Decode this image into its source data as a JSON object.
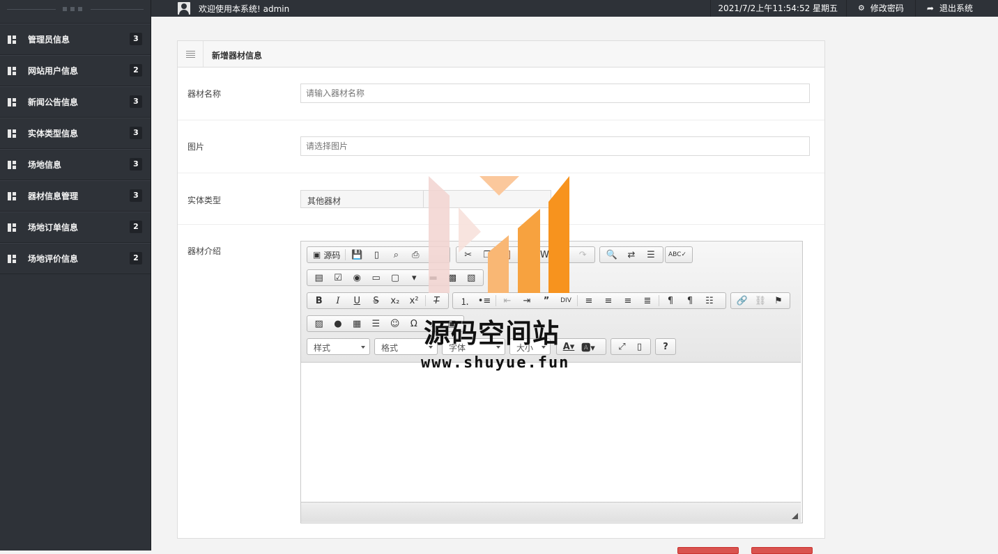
{
  "sidebar": {
    "items": [
      {
        "label": "管理员信息",
        "badge": "3"
      },
      {
        "label": "网站用户信息",
        "badge": "2"
      },
      {
        "label": "新闻公告信息",
        "badge": "3"
      },
      {
        "label": "实体类型信息",
        "badge": "3"
      },
      {
        "label": "场地信息",
        "badge": "3"
      },
      {
        "label": "器材信息管理",
        "badge": "3"
      },
      {
        "label": "场地订单信息",
        "badge": "2"
      },
      {
        "label": "场地评价信息",
        "badge": "2"
      }
    ]
  },
  "topbar": {
    "welcome": "欢迎使用本系统! admin",
    "datetime": "2021/7/2上午11:54:52 星期五",
    "change_password": "修改密码",
    "logout": "退出系统"
  },
  "panel": {
    "title": "新增器材信息",
    "fields": {
      "name_label": "器材名称",
      "name_placeholder": "请输入器材名称",
      "image_label": "图片",
      "image_placeholder": "请选择图片",
      "type_label": "实体类型",
      "type_value": "其他器材",
      "intro_label": "器材介绍"
    }
  },
  "editor": {
    "source_label": "源码",
    "combos": {
      "style": "样式",
      "format": "格式",
      "font": "字体",
      "size": "大小"
    },
    "help_label": "?"
  },
  "watermark": {
    "text": "源码空间站",
    "url": "www.shuyue.fun"
  },
  "colors": {
    "sidebar_bg": "#2e3238",
    "accent_orange": "#f7931e",
    "danger": "#d9534f"
  }
}
